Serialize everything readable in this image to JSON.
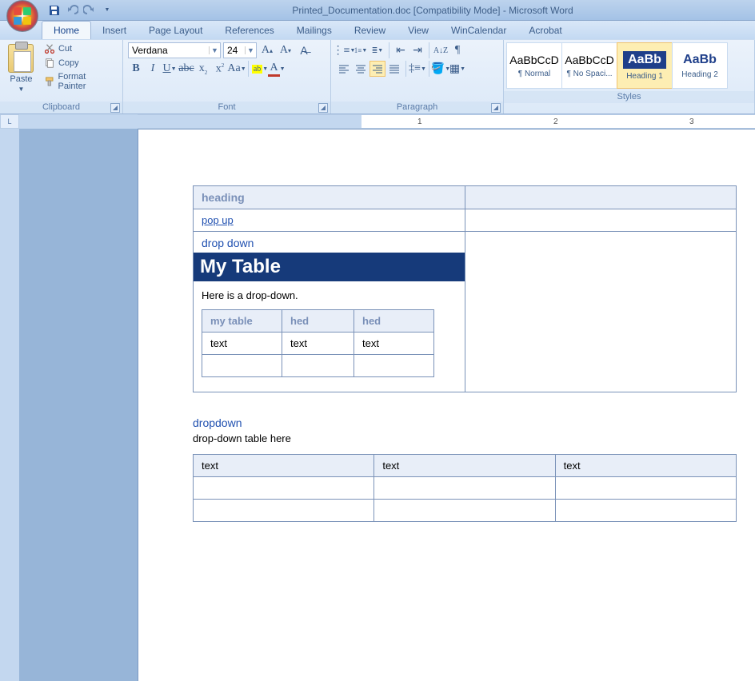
{
  "titlebar": {
    "title": "Printed_Documentation.doc [Compatibility Mode] - Microsoft Word"
  },
  "tabs": {
    "items": [
      "Home",
      "Insert",
      "Page Layout",
      "References",
      "Mailings",
      "Review",
      "View",
      "WinCalendar",
      "Acrobat"
    ],
    "active": 0
  },
  "ribbon": {
    "groups": {
      "clipboard": {
        "label": "Clipboard",
        "paste": "Paste",
        "cut": "Cut",
        "copy": "Copy",
        "format_painter": "Format Painter"
      },
      "font": {
        "label": "Font",
        "name": "Verdana",
        "size": "24"
      },
      "paragraph": {
        "label": "Paragraph"
      },
      "styles": {
        "label": "Styles",
        "items": [
          {
            "preview": "AaBbCcD",
            "name": "¶ Normal",
            "cls": ""
          },
          {
            "preview": "AaBbCcD",
            "name": "¶ No Spaci...",
            "cls": ""
          },
          {
            "preview": "AaBb",
            "name": "Heading 1",
            "cls": "h1"
          },
          {
            "preview": "AaBb",
            "name": "Heading 2",
            "cls": "h2"
          }
        ]
      }
    }
  },
  "ruler": {
    "marks": [
      "1",
      "2",
      "3"
    ]
  },
  "document": {
    "main_table": {
      "heading": "heading",
      "popup": "pop up",
      "dropdown_heading": "drop down",
      "banner": "My Table",
      "dd_text": "Here is a drop-down.",
      "inner_headers": [
        "my table",
        "hed",
        "hed"
      ],
      "inner_row": [
        "text",
        "text",
        "text"
      ]
    },
    "second": {
      "title": "dropdown",
      "text": "drop-down table here",
      "row": [
        "text",
        "text",
        "text"
      ]
    }
  }
}
